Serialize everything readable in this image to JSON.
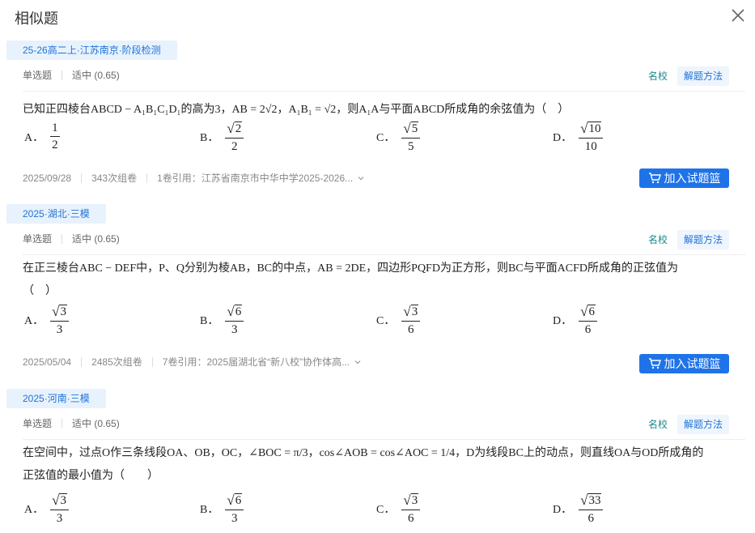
{
  "dialog": {
    "title": "相似题"
  },
  "cards": [
    {
      "source": "25-26高二上·江苏南京·阶段检测",
      "type": "单选题",
      "difficulty": "适中 (0.65)",
      "school_label": "名校",
      "method_label": "解题方法",
      "question_prefix": "已知正四棱台",
      "question_body": "ABCD − A₁B₁C₁D₁的高为3，AB = 2√2，A₁B₁ = √2，则A₁A与平面ABCD所成角的余弦值为（　）",
      "options": [
        {
          "letter": "A．",
          "num": "1",
          "den": "2",
          "sqrt": false
        },
        {
          "letter": "B．",
          "num": "2",
          "den": "2",
          "sqrt": true
        },
        {
          "letter": "C．",
          "num": "5",
          "den": "5",
          "sqrt": true
        },
        {
          "letter": "D．",
          "num": "10",
          "den": "10",
          "sqrt": true
        }
      ],
      "date": "2025/09/28",
      "used": "343次组卷",
      "cite": "1卷引用：江苏省南京市中华中学2025-2026...",
      "add_label": "加入试题篮"
    },
    {
      "source": "2025·湖北·三模",
      "type": "单选题",
      "difficulty": "适中 (0.65)",
      "school_label": "名校",
      "method_label": "解题方法",
      "question_line1": "在正三棱台ABC − DEF中，P、Q分别为棱AB，BC的中点，AB = 2DE，四边形PQFD为正方形，则BC与平面ACFD所成角的正弦值为",
      "question_line2": "（　）",
      "options": [
        {
          "letter": "A．",
          "num": "3",
          "den": "3",
          "sqrt": true
        },
        {
          "letter": "B．",
          "num": "6",
          "den": "3",
          "sqrt": true
        },
        {
          "letter": "C．",
          "num": "3",
          "den": "6",
          "sqrt": true
        },
        {
          "letter": "D．",
          "num": "6",
          "den": "6",
          "sqrt": true
        }
      ],
      "date": "2025/05/04",
      "used": "2485次组卷",
      "cite": "7卷引用：2025届湖北省“新八校”协作体高...",
      "add_label": "加入试题篮"
    },
    {
      "source": "2025·河南·三模",
      "type": "单选题",
      "difficulty": "适中 (0.65)",
      "school_label": "名校",
      "method_label": "解题方法",
      "question_line1": "在空间中，过点O作三条线段OA、OB，OC，∠BOC = π/3，cos∠AOB = cos∠AOC = 1/4，D为线段BC上的动点，则直线OA与OD所成角的",
      "question_line2": "正弦值的最小值为（　　）",
      "options": [
        {
          "letter": "A．",
          "num": "3",
          "den": "3",
          "sqrt": true
        },
        {
          "letter": "B．",
          "num": "6",
          "den": "3",
          "sqrt": true
        },
        {
          "letter": "C．",
          "num": "3",
          "den": "6",
          "sqrt": true
        },
        {
          "letter": "D．",
          "num": "33",
          "den": "6",
          "sqrt": true
        }
      ]
    }
  ],
  "colors": {
    "accent": "#1f73e8",
    "tag_bg": "#e8f2fd",
    "teal": "#1a8a8a"
  }
}
